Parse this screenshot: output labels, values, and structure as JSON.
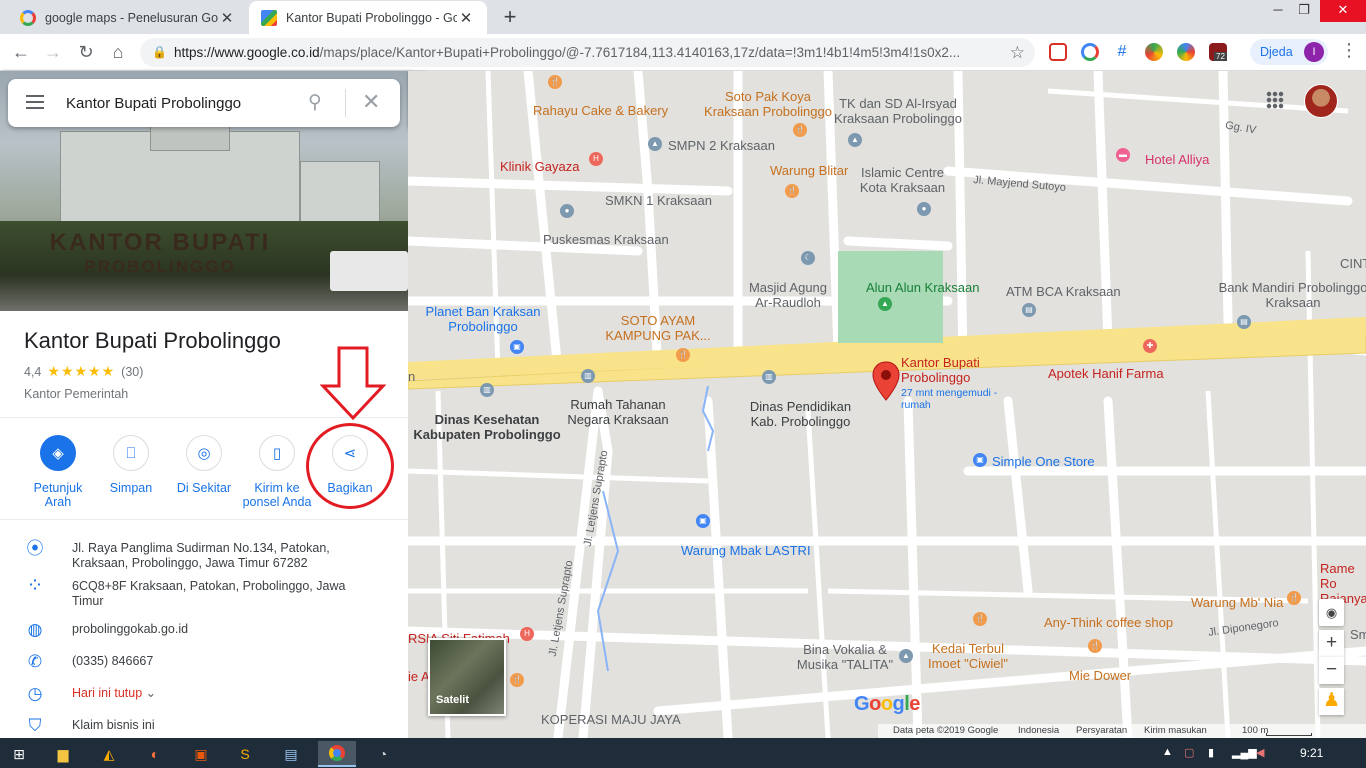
{
  "browser": {
    "tabs": [
      {
        "title": "google maps - Penelusuran Goo"
      },
      {
        "title": "Kantor Bupati Probolinggo - Goo"
      }
    ],
    "url_host": "https://www.google.co.id",
    "url_path": "/maps/place/Kantor+Bupati+Probolinggo/@-7.7617184,113.4140163,17z/data=!3m1!4b1!4m5!3m4!1s0x2...",
    "profile_label": "Djeda",
    "profile_initial": "I",
    "extension_badge": "72"
  },
  "search": {
    "value": "Kantor Bupati Probolinggo"
  },
  "place": {
    "title": "Kantor Bupati Probolinggo",
    "rating": "4,4",
    "stars": "★★★★★",
    "reviews": "(30)",
    "type": "Kantor Pemerintah",
    "photo_sign": "KANTOR BUPATI",
    "photo_sign2": "PROBOLINGGO"
  },
  "actions": [
    {
      "label": "Petunjuk Arah"
    },
    {
      "label": "Simpan"
    },
    {
      "label": "Di Sekitar"
    },
    {
      "label": "Kirim ke ponsel Anda"
    },
    {
      "label": "Bagikan"
    }
  ],
  "info": {
    "address": "Jl. Raya Panglima Sudirman No.134, Patokan, Kraksaan, Probolinggo, Jawa Timur 67282",
    "plus_code": "6CQ8+8F Kraksaan, Patokan, Probolinggo, Jawa Timur",
    "website": "probolinggokab.go.id",
    "phone": "(0335) 846667",
    "hours": "Hari ini tutup",
    "claim": "Klaim bisnis ini"
  },
  "map": {
    "labels": {
      "rahayu": "Rahayu Cake & Bakery",
      "sotopak": "Soto Pak Koya Kraksaan Probolinggo",
      "tk": "TK dan SD Al-Irsyad Kraksaan Probolinggo",
      "smpn": "SMPN 2 Kraksaan",
      "klinik": "Klinik Gayaza",
      "warungblitar": "Warung Blitar",
      "islamic": "Islamic Centre Kota Kraksaan",
      "hotel": "Hotel Alliya",
      "jlmayjend": "Jl. Mayjend Sutoyo",
      "gg": "Gg. IV",
      "smkn": "SMKN 1 Kraksaan",
      "puskesmas": "Puskesmas Kraksaan",
      "masjid": "Masjid Agung Ar-Raudloh",
      "alun": "Alun Alun Kraksaan",
      "atm": "ATM BCA Kraksaan",
      "mandiri": "Bank Mandiri Probolinggo Kraksaan",
      "cint": "CINT",
      "planet": "Planet Ban Kraksan Probolinggo",
      "sotoayam": "SOTO AYAM KAMPUNG PAK...",
      "kantor": "Kantor Bupati Probolinggo",
      "kantor_sub": "27 mnt mengemudi - rumah",
      "apotek": "Apotek Hanif Farma",
      "dinkes": "Dinas Kesehatan Kabupaten Probolinggo",
      "rumah": "Rumah Tahanan Negara Kraksaan",
      "dinpen": "Dinas Pendidikan Kab. Probolinggo",
      "simple": "Simple One Store",
      "warungmbak": "Warung Mbak LASTRI",
      "jlsup1": "Jl. Letjens Suprapto",
      "jlsup2": "Jl. Letjens Suprapto",
      "rame": "Rame Ro Rajanya",
      "warungmb": "Warung Mb' Nia",
      "anythink": "Any-Think coffee shop",
      "jldipo": "Jl. Diponegoro",
      "rsia": "RSIA Siti Fatimah",
      "bina": "Bina Vokalia & Musika \"TALITA\"",
      "kedai": "Kedai Terbul Imoet \"Ciwiel\"",
      "mie": "Mie Dower",
      "koperasi": "KOPERASI MAJU JAYA",
      "leftie": "ie A",
      "rightsm": "Sm",
      "roadn": "n"
    },
    "satellite_label": "Satelit",
    "google_logo": "Google",
    "attribution": [
      "Data peta ©2019 Google",
      "Indonesia",
      "Persyaratan",
      "Kirim masukan",
      "100 m"
    ]
  },
  "taskbar": {
    "time": "9:21"
  },
  "colors": {
    "accent": "#1a73e8",
    "marker": "#ea4335",
    "highlight": "#e31b23",
    "road_main": "#f8e38a"
  }
}
